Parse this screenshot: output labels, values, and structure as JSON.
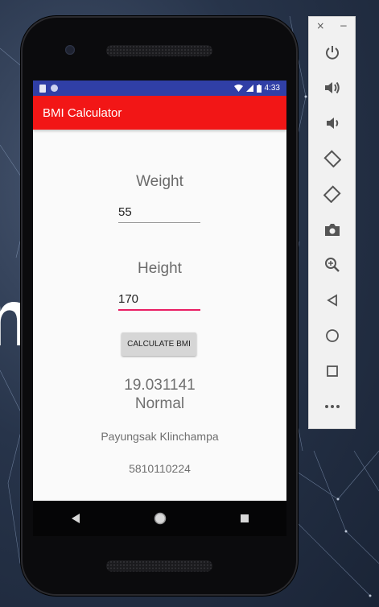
{
  "status_bar": {
    "time": "4:33"
  },
  "app_bar": {
    "title": "BMI Calculator"
  },
  "weight": {
    "label": "Weight",
    "value": "55"
  },
  "height": {
    "label": "Height",
    "value": "170"
  },
  "calculate_button": {
    "label": "CALCULATE BMI"
  },
  "result": {
    "bmi": "19.031141",
    "category": "Normal"
  },
  "author": {
    "name": "Payungsak Klinchampa",
    "id": "5810110224"
  },
  "emulator_panel": {
    "close_glyph": "×",
    "minimize_glyph": "−",
    "items": [
      "power-icon",
      "volume-up-icon",
      "volume-down-icon",
      "rotate-left-icon",
      "rotate-right-icon",
      "camera-icon",
      "zoom-icon",
      "back-icon",
      "home-icon",
      "overview-icon",
      "more-icon"
    ]
  },
  "colors": {
    "app_bar": "#f21616",
    "status_bar": "#303fa6",
    "accent": "#e91e63"
  }
}
